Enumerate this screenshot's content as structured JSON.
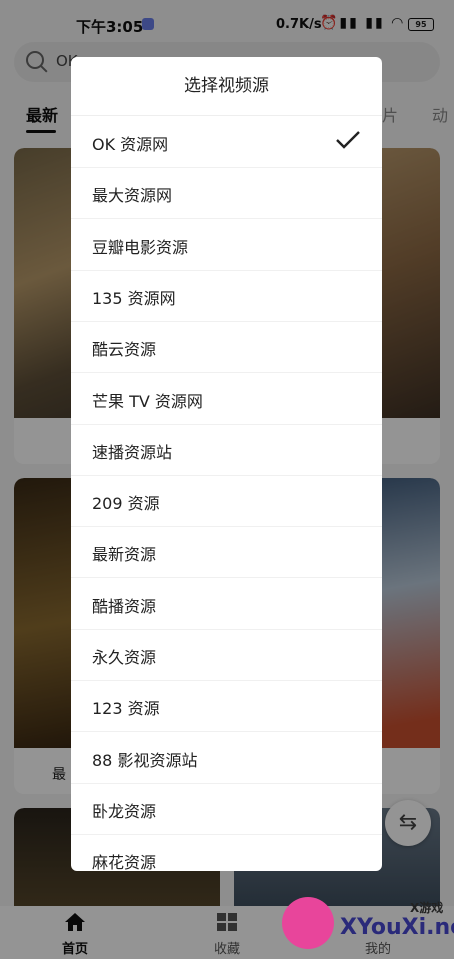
{
  "status_bar": {
    "time": "下午3:05",
    "speed": "0.7K/s",
    "battery": "95"
  },
  "search": {
    "text": "OK"
  },
  "tabs": [
    {
      "label": "最新",
      "active": true
    },
    {
      "label": "片"
    },
    {
      "label": "动"
    }
  ],
  "cards": [
    {
      "title": ""
    },
    {
      "title": ""
    },
    {
      "title": "最"
    },
    {
      "title": ""
    }
  ],
  "dialog": {
    "title": "选择视频源",
    "items": [
      {
        "label": "OK 资源网",
        "selected": true
      },
      {
        "label": "最大资源网"
      },
      {
        "label": "豆瓣电影资源"
      },
      {
        "label": "135 资源网"
      },
      {
        "label": "酷云资源"
      },
      {
        "label": "芒果 TV 资源网"
      },
      {
        "label": "速播资源站"
      },
      {
        "label": "209 资源"
      },
      {
        "label": "最新资源"
      },
      {
        "label": "酷播资源"
      },
      {
        "label": "永久资源"
      },
      {
        "label": "123 资源"
      },
      {
        "label": "88 影视资源站"
      },
      {
        "label": "卧龙资源"
      },
      {
        "label": "麻花资源"
      }
    ]
  },
  "bottom_nav": {
    "home": "首页",
    "favorites": "收藏",
    "mine": "我的"
  },
  "watermark": {
    "small": "X游戏",
    "big": "XYouXi.net"
  },
  "colors": {
    "accent": "#111111",
    "overlay": "rgba(0,0,0,0.42)",
    "watermark_pink": "#e8459b"
  }
}
